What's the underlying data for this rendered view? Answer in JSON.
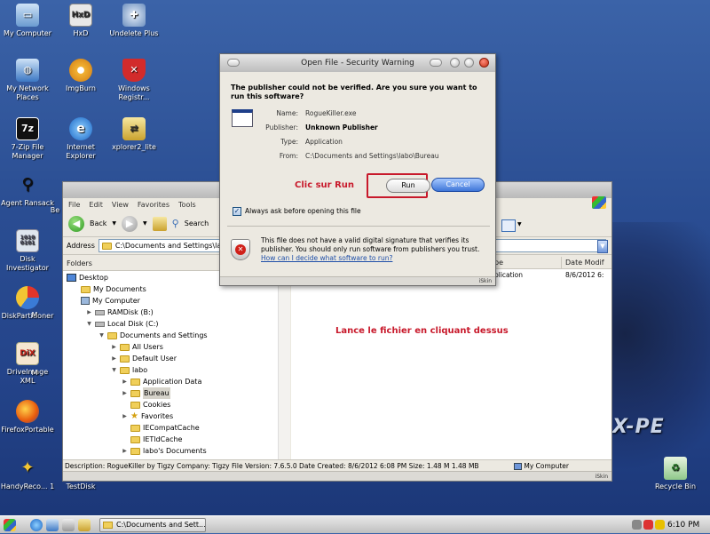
{
  "desktop": {
    "icons": [
      {
        "label": "My Computer",
        "icon": "computer-icon"
      },
      {
        "label": "HxD",
        "icon": "hex-editor-icon"
      },
      {
        "label": "Undelete Plus",
        "icon": "undelete-icon"
      },
      {
        "label": "My Network Places",
        "icon": "network-icon"
      },
      {
        "label": "ImgBurn",
        "icon": "disc-icon"
      },
      {
        "label": "Windows Registr...",
        "icon": "registry-icon"
      },
      {
        "label": "7-Zip File Manager",
        "icon": "zip-icon"
      },
      {
        "label": "Internet Explorer",
        "icon": "ie-icon"
      },
      {
        "label": "xplorer2_lite",
        "icon": "xplorer-icon"
      },
      {
        "label": "Agent Ransack",
        "icon": "search-agent-icon"
      },
      {
        "label": "Disk Investigator",
        "icon": "disk-icon"
      },
      {
        "label": "DiskPartitioner",
        "icon": "partition-icon"
      },
      {
        "label": "DriveImage XML",
        "icon": "driveimage-icon"
      },
      {
        "label": "FirefoxPortable",
        "icon": "firefox-icon"
      },
      {
        "label": "HandyReco... 1",
        "icon": "handyrecovery-icon"
      },
      {
        "label": "TestDisk",
        "icon": "testdisk-icon"
      },
      {
        "label": "Recycle Bin",
        "icon": "recycle-bin-icon"
      }
    ],
    "partial_labels": {
      "m1": "M",
      "m2": "M",
      "be": "Be"
    },
    "wallpaper_logo": "X-PE"
  },
  "explorer": {
    "menu": [
      "File",
      "Edit",
      "View",
      "Favorites",
      "Tools"
    ],
    "toolbar": {
      "back": "Back",
      "search": "Search"
    },
    "address_label": "Address",
    "address_value": "C:\\Documents and Settings\\labo",
    "folders_label": "Folders",
    "tree": [
      {
        "label": "Desktop",
        "level": 0
      },
      {
        "label": "My Documents",
        "level": 1
      },
      {
        "label": "My Computer",
        "level": 1
      },
      {
        "label": "RAMDisk (B:)",
        "level": 2
      },
      {
        "label": "Local Disk (C:)",
        "level": 2
      },
      {
        "label": "Documents and Settings",
        "level": 3
      },
      {
        "label": "All Users",
        "level": 4
      },
      {
        "label": "Default User",
        "level": 4
      },
      {
        "label": "labo",
        "level": 4
      },
      {
        "label": "Application Data",
        "level": 5
      },
      {
        "label": "Bureau",
        "level": 5
      },
      {
        "label": "Cookies",
        "level": 5
      },
      {
        "label": "Favorites",
        "level": 5
      },
      {
        "label": "IECompatCache",
        "level": 5
      },
      {
        "label": "IETldCache",
        "level": 5
      },
      {
        "label": "labo's Documents",
        "level": 5
      }
    ],
    "columns": {
      "type": "pe",
      "date": "Date Modif"
    },
    "file_row": {
      "type": "plication",
      "date": "8/6/2012 6:"
    },
    "status_description": "Description: RogueKiller by Tigzy Company: Tigzy File Version: 7.6.5.0 Date Created: 8/6/2012 6:08 PM Size: 1.48 M 1.48 MB",
    "status_location": "My Computer",
    "skin_label": "iSkin"
  },
  "dialog": {
    "title": "Open File - Security Warning",
    "question": "The publisher could not be verified.  Are you sure you want to run this software?",
    "fields": [
      {
        "label": "Name:",
        "value": "RogueKiller.exe",
        "bold": false
      },
      {
        "label": "Publisher:",
        "value": "Unknown Publisher",
        "bold": true
      },
      {
        "label": "Type:",
        "value": "Application",
        "bold": false
      },
      {
        "label": "From:",
        "value": "C:\\Documents and Settings\\labo\\Bureau",
        "bold": false
      }
    ],
    "run_label": "Run",
    "cancel_label": "Cancel",
    "checkbox_label": "Always ask before opening this file",
    "checkbox_checked": true,
    "warning_text": "This file does not have a valid digital signature that verifies its publisher.  You should only run software from publishers you trust.",
    "warning_link": "How can I decide what software to run?",
    "skin_label": "iSkin"
  },
  "annotations": {
    "run_hint": "Clic sur Run",
    "launch_hint": "Lance le fichier en cliquant dessus",
    "color": "#c8192b"
  },
  "taskbar": {
    "task_label": "C:\\Documents and Sett...",
    "clock": "6:10 PM"
  }
}
